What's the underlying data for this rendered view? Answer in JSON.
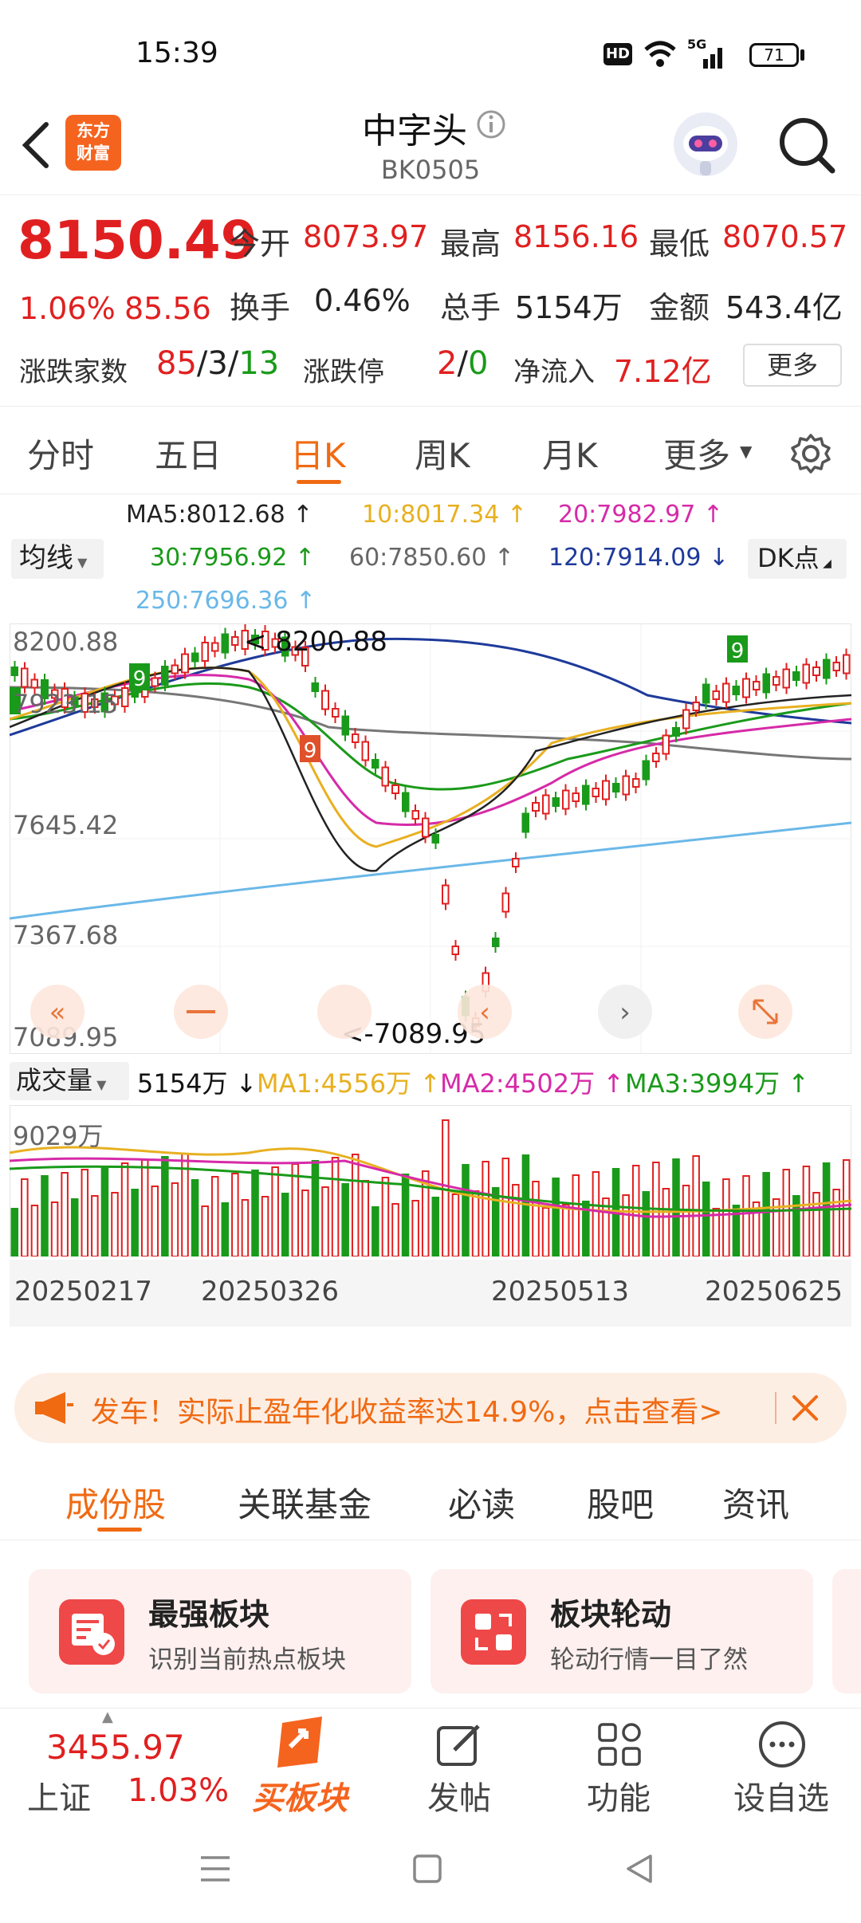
{
  "status": {
    "time": "15:39",
    "battery": "71",
    "hd": "HD",
    "signal": "5G"
  },
  "nav": {
    "title": "中字头",
    "code": "BK0505",
    "logo_line1": "东方",
    "logo_line2": "财富"
  },
  "quote": {
    "price": "8150.49",
    "change_pct": "1.06%",
    "change": "85.56",
    "open_label": "今开",
    "open": "8073.97",
    "high_label": "最高",
    "high": "8156.16",
    "low_label": "最低",
    "low": "8070.57",
    "turnover_label": "换手",
    "turnover": "0.46%",
    "volume_label": "总手",
    "volume": "5154万",
    "amount_label": "金额",
    "amount": "543.4亿",
    "breadth_label": "涨跌家数",
    "breadth_up": "85",
    "breadth_flat": "3",
    "breadth_down": "13",
    "limit_label": "涨跌停",
    "limit_up": "2",
    "limit_down": "0",
    "inflow_label": "净流入",
    "inflow": "7.12亿",
    "more_button": "更多"
  },
  "tabs": [
    "分时",
    "五日",
    "日K",
    "周K",
    "月K",
    "更多"
  ],
  "ma": {
    "selector": "均线",
    "dk": "DK点",
    "ma5": "MA5:8012.68",
    "ma10": "10:8017.34",
    "ma20": "20:7982.97",
    "ma30": "30:7956.92",
    "ma60": "60:7850.60",
    "ma120": "120:7914.09",
    "ma250": "250:7696.36"
  },
  "chart_axes": {
    "y_max": "8200.88",
    "y_2": "7923.15",
    "y_3": "7645.42",
    "y_4": "7367.68",
    "y_min": "7089.95",
    "max_annot": "< 8200.88",
    "min_annot": "<-7089.95",
    "vol_max": "9029万"
  },
  "volume": {
    "selector": "成交量",
    "vol": "5154万",
    "ma1": "MA1:4556万",
    "ma2": "MA2:4502万",
    "ma3": "MA3:3994万"
  },
  "dates": [
    "20250217",
    "20250326",
    "20250513",
    "20250625"
  ],
  "chart_data": {
    "type": "candlestick",
    "ylim": [
      7089.95,
      8200.88
    ],
    "high": 8200.88,
    "low": 7089.95,
    "last": 8150.49,
    "dates_shown": [
      "20250217",
      "20250326",
      "20250513",
      "20250625"
    ],
    "ma": {
      "MA5": 8012.68,
      "MA10": 8017.34,
      "MA20": 7982.97,
      "MA30": 7956.92,
      "MA60": 7850.6,
      "MA120": 7914.09,
      "MA250": 7696.36
    },
    "volume_max": "9029万",
    "volume_last": "5154万"
  },
  "banner": {
    "text": "发车！实际止盈年化收益率达14.9%，点击查看>"
  },
  "subtabs": [
    "成份股",
    "关联基金",
    "必读",
    "股吧",
    "资讯"
  ],
  "cards": [
    {
      "title": "最强板块",
      "subtitle": "识别当前热点板块"
    },
    {
      "title": "板块轮动",
      "subtitle": "轮动行情一目了然"
    }
  ],
  "bottom": {
    "index_value": "3455.97",
    "index_name": "上证",
    "index_pct": "1.03%",
    "buy": "买板块",
    "post": "发帖",
    "func": "功能",
    "watch": "设自选"
  },
  "colors": {
    "up": "#e02020",
    "down": "#1a9a1a",
    "accent": "#f06a12"
  }
}
